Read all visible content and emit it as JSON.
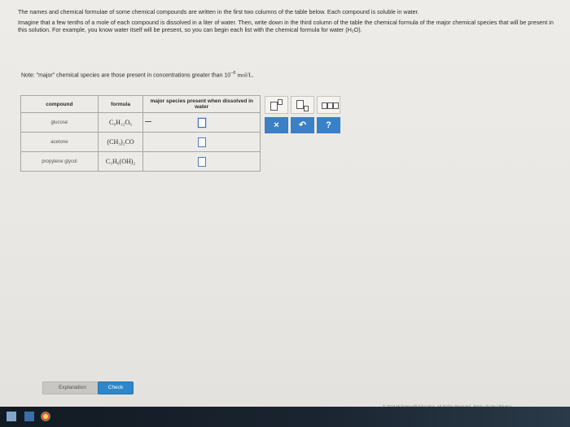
{
  "intro": {
    "p1": "The names and chemical formulae of some chemical compounds are written in the first two columns of the table below. Each compound is soluble in water.",
    "p2": "Imagine that a few tenths of a mole of each compound is dissolved in a liter of water. Then, write down in the third column of the table the chemical formula of the major chemical species that will be present in this solution. For example, you know water itself will be present, so you can begin each list with the chemical formula for water (H₂O)."
  },
  "note": {
    "text": "Note: \"major\" chemical species are those present in concentrations greater than",
    "base": "10",
    "exp": "−6",
    "unit": "mol/L."
  },
  "table": {
    "headers": [
      "compound",
      "formula",
      "major species present when dissolved in water"
    ],
    "rows": [
      {
        "compound": "glucose",
        "formula": "C₆H₁₂O₆"
      },
      {
        "compound": "acetone",
        "formula": "(CH₃)₂CO"
      },
      {
        "compound": "propylene glycol",
        "formula": "C₃H₆(OH)₂"
      }
    ]
  },
  "toolbox": {
    "clear_label": "×",
    "undo_label": "↶",
    "help_label": "?"
  },
  "buttons": {
    "explanation": "Explanation",
    "check": "Check"
  },
  "footer": "© 2019 McGraw-Hill Education. All Rights Reserved.  Terms of Use  |  Privacy"
}
